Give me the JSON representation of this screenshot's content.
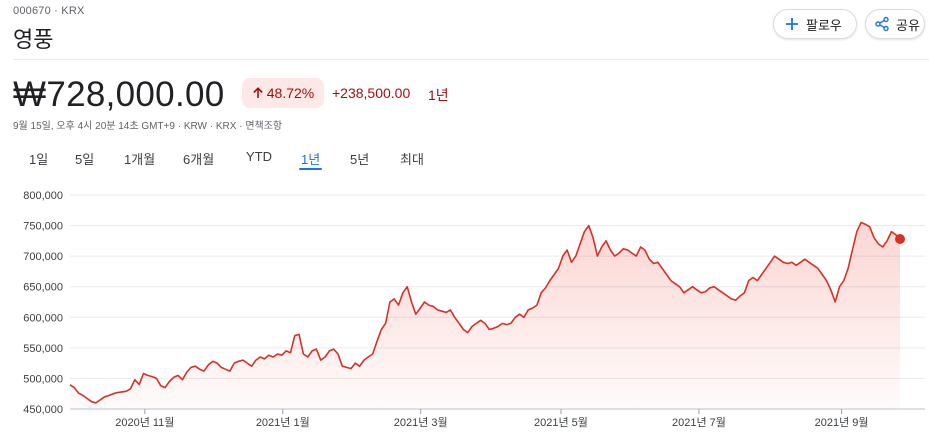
{
  "header": {
    "ticker": "000670 · KRX",
    "company_name": "영풍",
    "follow_label": "팔로우",
    "share_label": "공유"
  },
  "quote": {
    "price": "₩728,000.00",
    "change_percent": "48.72%",
    "change_abs": "+238,500.00",
    "change_period": "1년",
    "meta": "9월 15일, 오후 4시 20분 14초 GMT+9 · KRW · KRX · 면책조항",
    "trend_color": "#d93025"
  },
  "tabs": [
    {
      "label": "1일",
      "active": false
    },
    {
      "label": "5일",
      "active": false
    },
    {
      "label": "1개월",
      "active": false
    },
    {
      "label": "6개월",
      "active": false
    },
    {
      "label": "YTD",
      "active": false
    },
    {
      "label": "1년",
      "active": true
    },
    {
      "label": "5년",
      "active": false
    },
    {
      "label": "최대",
      "active": false
    }
  ],
  "chart_data": {
    "type": "area",
    "title": "",
    "xlabel": "",
    "ylabel": "",
    "ylim": [
      450000,
      800000
    ],
    "y_ticks": [
      800000,
      750000,
      700000,
      650000,
      600000,
      550000,
      500000,
      450000
    ],
    "y_tick_labels": [
      "800,000",
      "750,000",
      "700,000",
      "650,000",
      "600,000",
      "550,000",
      "500,000",
      "450,000"
    ],
    "x_tick_labels": [
      "2020년 11월",
      "2021년 1월",
      "2021년 3월",
      "2021년 5월",
      "2021년 7월",
      "2021년 9월"
    ],
    "x_tick_positions": [
      32,
      91,
      150,
      210,
      269,
      330
    ],
    "x_range": [
      0,
      355
    ],
    "grid": true,
    "series": [
      {
        "values": [
          489500,
          485000,
          476000,
          472000,
          467000,
          462000,
          460000,
          465000,
          470000,
          472000,
          475000,
          477000,
          478000,
          479000,
          483000,
          498000,
          490000,
          508000,
          505000,
          503000,
          500000,
          488000,
          485000,
          495000,
          502000,
          505000,
          498000,
          510000,
          518000,
          520000,
          515000,
          512000,
          522000,
          528000,
          525000,
          518000,
          515000,
          512000,
          525000,
          528000,
          530000,
          525000,
          520000,
          530000,
          535000,
          532000,
          538000,
          535000,
          540000,
          538000,
          545000,
          542000,
          570000,
          572000,
          540000,
          535000,
          545000,
          548000,
          530000,
          535000,
          545000,
          548000,
          540000,
          520000,
          518000,
          516000,
          525000,
          520000,
          530000,
          535000,
          540000,
          560000,
          580000,
          590000,
          625000,
          630000,
          620000,
          640000,
          650000,
          625000,
          605000,
          615000,
          625000,
          620000,
          618000,
          612000,
          610000,
          608000,
          612000,
          600000,
          590000,
          580000,
          575000,
          585000,
          590000,
          595000,
          590000,
          580000,
          582000,
          585000,
          590000,
          588000,
          590000,
          600000,
          605000,
          600000,
          612000,
          615000,
          620000,
          640000,
          648000,
          660000,
          670000,
          680000,
          700000,
          710000,
          690000,
          700000,
          720000,
          740000,
          750000,
          730000,
          700000,
          715000,
          725000,
          710000,
          700000,
          705000,
          712000,
          710000,
          705000,
          700000,
          715000,
          710000,
          695000,
          688000,
          690000,
          680000,
          670000,
          660000,
          655000,
          650000,
          640000,
          645000,
          650000,
          645000,
          640000,
          642000,
          648000,
          650000,
          645000,
          640000,
          635000,
          630000,
          628000,
          635000,
          640000,
          660000,
          665000,
          660000,
          670000,
          680000,
          690000,
          700000,
          695000,
          690000,
          688000,
          690000,
          685000,
          690000,
          695000,
          690000,
          685000,
          680000,
          670000,
          660000,
          645000,
          625000,
          650000,
          660000,
          680000,
          710000,
          740000,
          755000,
          752000,
          748000,
          730000,
          720000,
          715000,
          725000,
          740000,
          735000,
          728000
        ]
      }
    ]
  }
}
